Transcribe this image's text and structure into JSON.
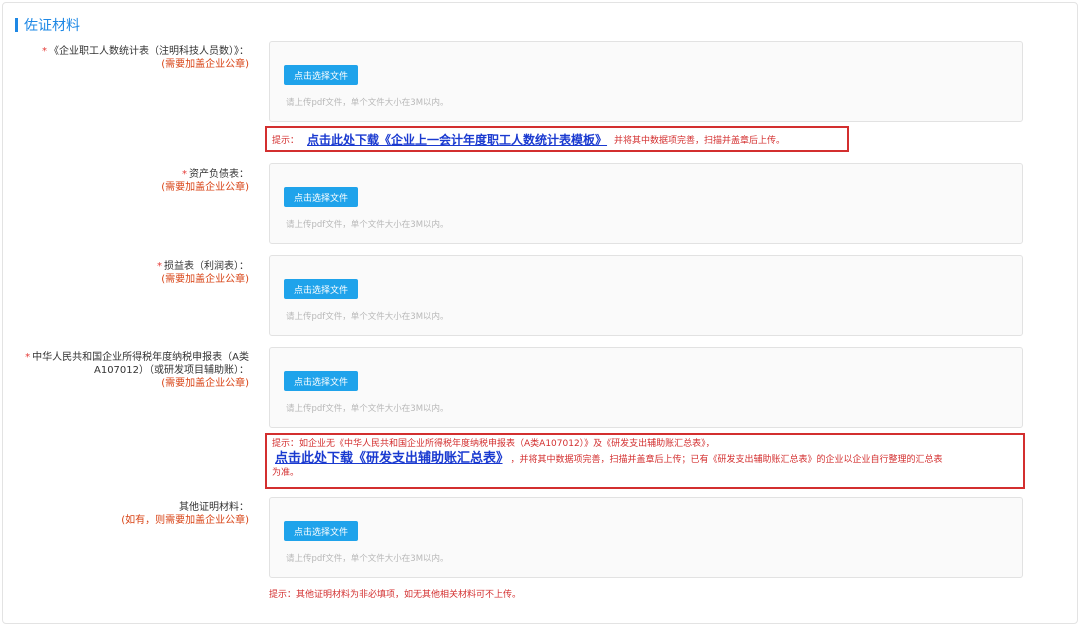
{
  "section": {
    "title": "佐证材料"
  },
  "upload": {
    "button_label": "点击选择文件",
    "hint": "请上传pdf文件，单个文件大小在3M以内。"
  },
  "fields": [
    {
      "label": "《企业职工人数统计表（注明科技人员数）》：",
      "note": "(需要加盖企业公章)",
      "required": "*"
    },
    {
      "label": "资产负债表：",
      "note": "(需要加盖企业公章)",
      "required": "*"
    },
    {
      "label": "损益表（利润表）：",
      "note": "(需要加盖企业公章)",
      "required": "*"
    },
    {
      "label_line1": "中华人民共和国企业所得税年度纳税申报表（A类",
      "label_line2": "A107012）（或研发项目辅助账）：",
      "note": "(需要加盖企业公章)",
      "required": "*"
    },
    {
      "label": "其他证明材料：",
      "note": "(如有，则需要加盖企业公章)"
    }
  ],
  "tips": {
    "tip1": {
      "prefix": "提示：",
      "link": "点击此处下载《企业上一会计年度职工人数统计表模板》",
      "suffix": "并将其中数据项完善，扫描并盖章后上传。"
    },
    "tip2": {
      "line1": "提示：如企业无《中华人民共和国企业所得税年度纳税申报表（A类A107012）》及《研发支出辅助账汇总表》，",
      "link": "点击此处下载《研发支出辅助账汇总表》",
      "suffix": "，并将其中数据项完善，扫描并盖章后上传；已有《研发支出辅助账汇总表》的企业以企业自行整理的汇总表",
      "line3": "为准。"
    },
    "tip3": "提示：其他证明材料为非必填项，如无其他相关材料可不上传。"
  }
}
